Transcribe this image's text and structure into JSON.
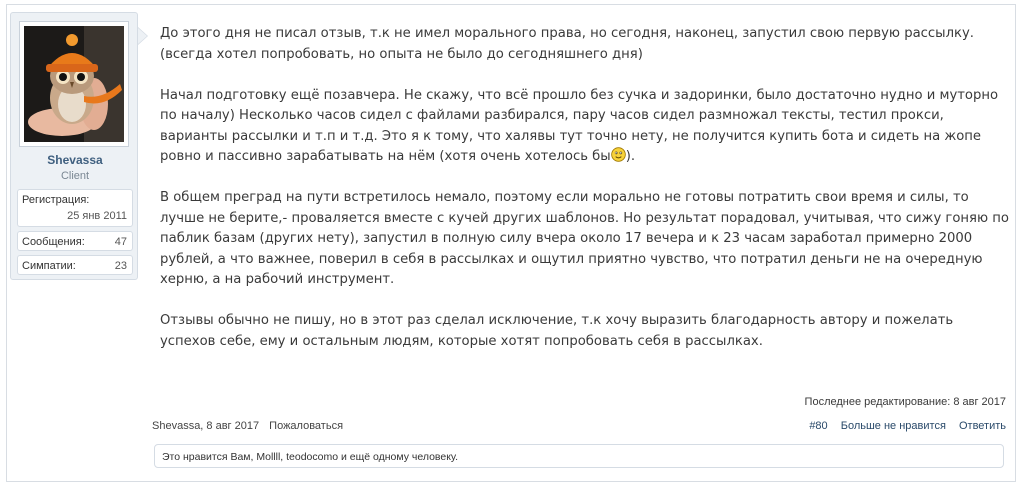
{
  "user": {
    "name": "Shevassa",
    "title": "Client",
    "avatar_icon": "owl-in-knit-hat-avatar",
    "stats": {
      "registration_label": "Регистрация:",
      "registration_value": "25 янв 2011",
      "messages_label": "Сообщения:",
      "messages_value": "47",
      "likes_label": "Симпатии:",
      "likes_value": "23"
    }
  },
  "message": {
    "p1": "До этого дня не писал отзыв, т.к не имел морального права, но сегодня, наконец, запустил свою первую рассылку. (всегда хотел попробовать, но опыта не было до сегодняшнего дня)",
    "p2_before": "Начал подготовку ещё позавчера. Не скажу, что всё прошло без сучка и задоринки, было достаточно нудно и муторно по началу) Несколько часов сидел с файлами разбирался, пару часов сидел размножал тексты, тестил прокси, варианты рассылки и т.п и т.д. Это я к тому, что халявы тут точно нету, не получится купить бота и сидеть на жопе ровно и пассивно зарабатывать на нём (хотя очень хотелось бы",
    "p2_after": ").",
    "p3": "В общем преград на пути встретилось немало, поэтому если морально не готовы потратить свои время и силы, то лучше не берите,- проваляется вместе с кучей других шаблонов. Но результат порадовал, учитывая, что сижу гоняю по паблик базам (других нету), запустил в полную силу вчера около 17 вечера и к 23 часам заработал примерно 2000 рублей, а что важнее, поверил в себя в рассылках и ощутил приятно чувство, что потратил деньги не на очередную херню, а на рабочий инструмент.",
    "p4": "Отзывы обычно не пишу, но в этот раз сделал исключение, т.к хочу выразить благодарность автору и пожелать успехов себе, ему и остальным людям, которые хотят попробовать себя в рассылках."
  },
  "edited": "Последнее редактирование: 8 авг 2017",
  "meta": {
    "author_date": "Shevassa, 8 авг 2017",
    "report": "Пожаловаться",
    "post_number": "#80",
    "unlike": "Больше не нравится",
    "reply": "Ответить"
  },
  "likes_summary": "Это нравится Вам, Mollll, teodocomo и ещё одному человеку."
}
